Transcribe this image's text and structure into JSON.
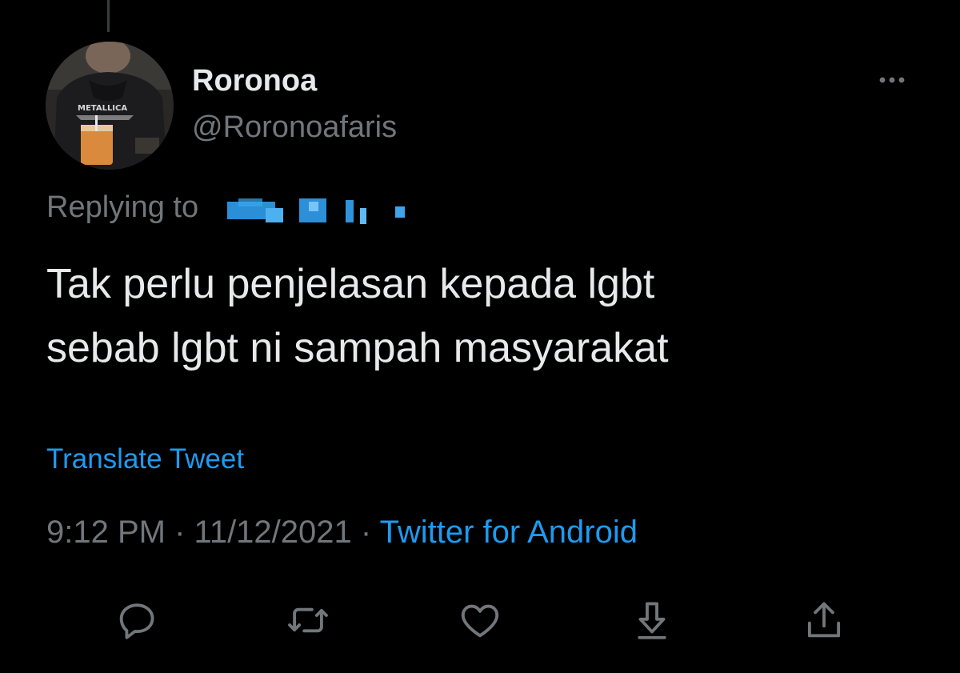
{
  "tweet": {
    "display_name": "Roronoa",
    "handle": "@Roronoafaris",
    "replying_prefix": "Replying to",
    "text": "Tak perlu penjelasan kepada lgbt\nsebab lgbt ni sampah masyarakat",
    "translate_label": "Translate Tweet",
    "time": "9:12 PM",
    "separator": "·",
    "date": "11/12/2021",
    "source": "Twitter for Android"
  },
  "avatar": {
    "shirt_text": "METALLICA"
  },
  "colors": {
    "background": "#000000",
    "primary_text": "#e7e9ea",
    "secondary_text": "#71767b",
    "link": "#1d9bf0",
    "icon": "#71767b"
  },
  "icons": {
    "more": "more-horizontal-icon",
    "reply": "reply-icon",
    "retweet": "retweet-icon",
    "like": "like-icon",
    "bookmark": "download-icon",
    "share": "share-icon"
  }
}
